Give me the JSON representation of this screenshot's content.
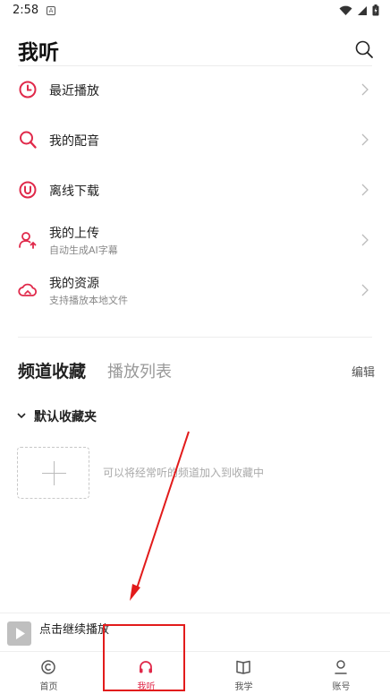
{
  "status_bar": {
    "time": "2:58",
    "notification_letter": "A"
  },
  "header": {
    "title": "我听"
  },
  "menu": [
    {
      "label": "最近播放",
      "sub": "",
      "icon": "clock-icon"
    },
    {
      "label": "我的配音",
      "sub": "",
      "icon": "microphone-search-icon"
    },
    {
      "label": "离线下载",
      "sub": "",
      "icon": "download-icon"
    },
    {
      "label": "我的上传",
      "sub": "自动生成AI字幕",
      "icon": "user-upload-icon"
    },
    {
      "label": "我的资源",
      "sub": "支持播放本地文件",
      "icon": "cloud-icon"
    }
  ],
  "tabs": {
    "active": "频道收藏",
    "inactive": "播放列表",
    "edit": "编辑"
  },
  "folder": {
    "title": "默认收藏夹",
    "hint": "可以将经常听的频道加入到收藏中"
  },
  "player": {
    "text": "点击继续播放"
  },
  "nav": [
    {
      "label": "首页",
      "icon": "home-icon"
    },
    {
      "label": "我听",
      "icon": "headphones-icon"
    },
    {
      "label": "我学",
      "icon": "book-icon"
    },
    {
      "label": "账号",
      "icon": "account-icon"
    }
  ],
  "colors": {
    "accent": "#e0294a",
    "annotation": "#e21b1b"
  }
}
